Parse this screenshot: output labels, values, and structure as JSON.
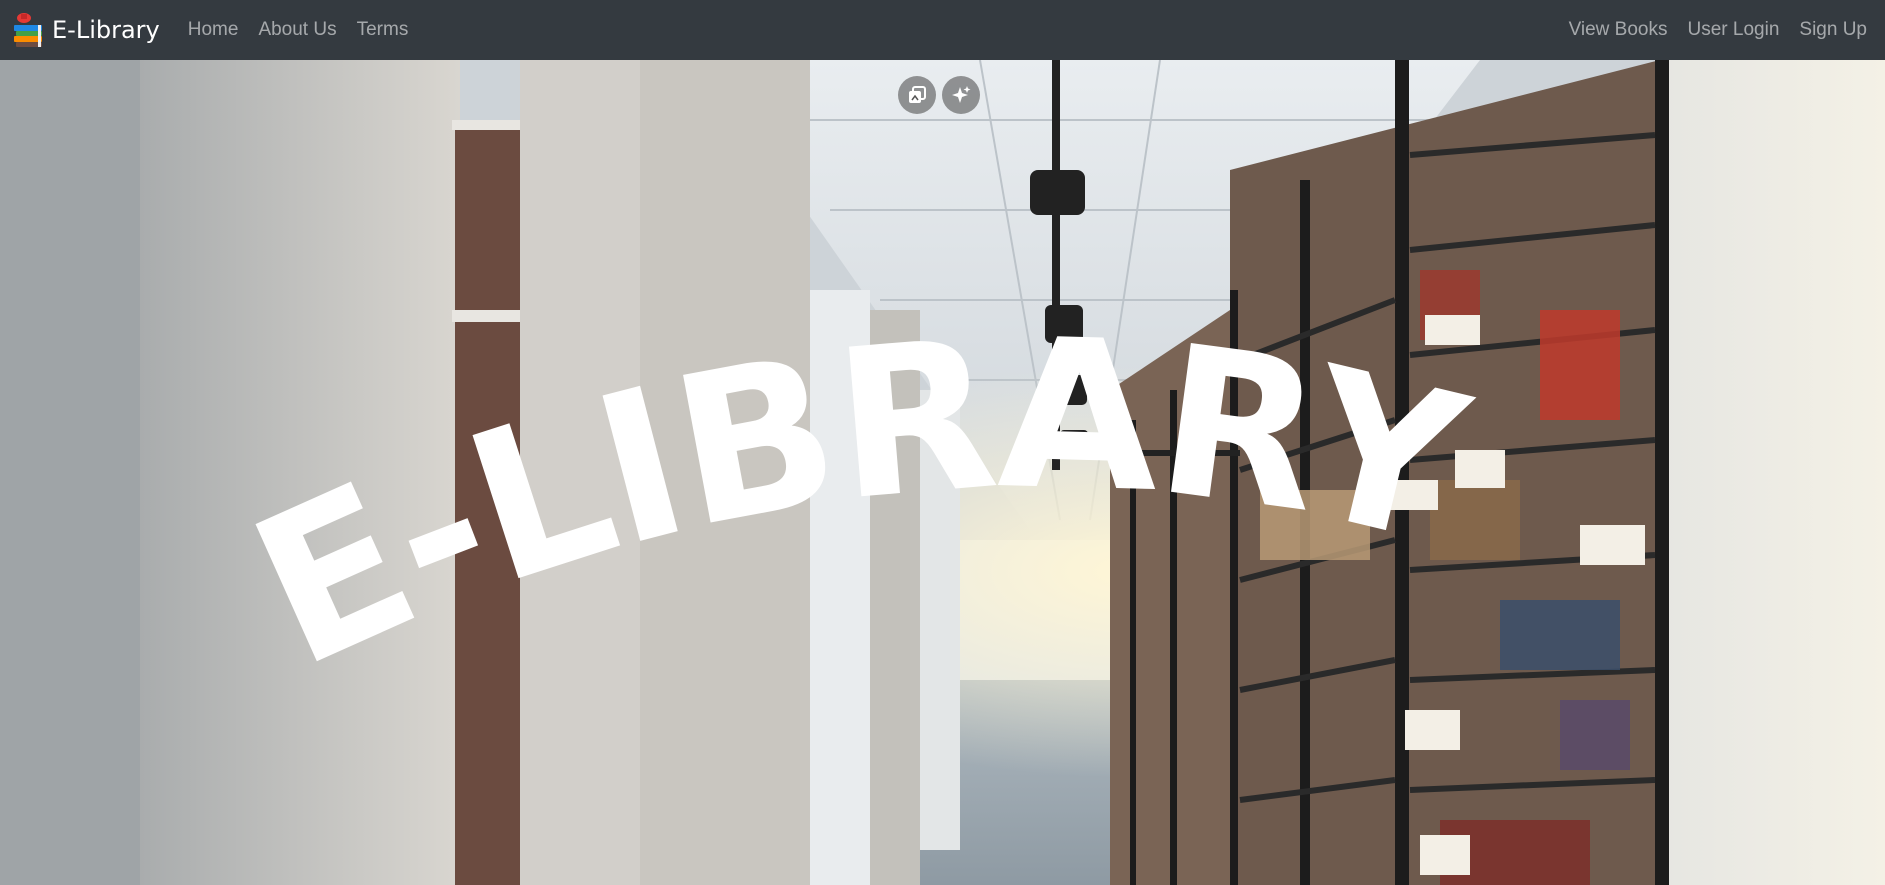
{
  "brand": {
    "name": "E-Library",
    "logo_icon": "books-stack-icon"
  },
  "nav_left": [
    "Home",
    "About Us",
    "Terms"
  ],
  "nav_right": [
    "View Books",
    "User Login",
    "Sign Up"
  ],
  "hero": {
    "title": "E-LIBRARY",
    "controls": [
      "copy-image-icon",
      "sparkle-icon"
    ]
  },
  "colors": {
    "navbar": "#343a40",
    "nav_link": "rgba(255,255,255,0.56)",
    "brand_text": "#ffffff",
    "title": "#ffffff"
  }
}
